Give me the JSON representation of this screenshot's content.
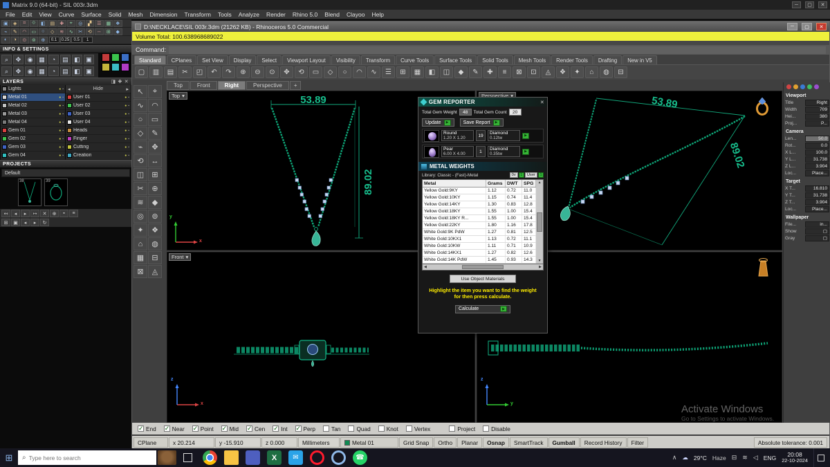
{
  "window": {
    "min": "─",
    "max": "▢",
    "close": "✕"
  },
  "icons": {
    "dd": "▾",
    "chip_arrow": "▶",
    "close": "✕",
    "plus": "+",
    "search": "⌕",
    "caret_up": "∧",
    "hide_left": "◂",
    "hide_right": "▸",
    "bulb": "●",
    "lock": "▪",
    "cloud": "☁",
    "scroll_up": "▲",
    "scroll_down": "▼",
    "scroll_left": "◀",
    "scroll_right": "▶",
    "start": "⊞",
    "tray": [
      "⊟",
      "≋",
      "◁"
    ],
    "excel_letter": "X",
    "mail_glyph": "✉",
    "whatsapp_glyph": "☎"
  },
  "matrix": {
    "title": "Matrix 9.0 (64-bit) - SIL 003r.3dm",
    "menus": [
      "File",
      "Edit",
      "View",
      "Curve",
      "Surface",
      "Solid",
      "Mesh",
      "Dimension",
      "Transform",
      "Tools",
      "Analyze",
      "Render",
      "Rhino 5.0",
      "Blend",
      "Clayoo",
      "Help"
    ],
    "toolbar_row1": [
      "▣",
      "◈",
      "⌗",
      "⟐",
      "◧",
      "▤",
      "✚",
      "⌖",
      "◎",
      "▞",
      "☰",
      "▦",
      "❖"
    ],
    "toolbar_row2": [
      "⌁",
      "✎",
      "◠",
      "▭",
      "○",
      "◇",
      "≋",
      "∿",
      "✂",
      "⟲",
      "↔",
      "⊞",
      "◆"
    ],
    "toolbar_row3": [
      "◐",
      "◑",
      "⊙",
      "⊚",
      "⊕"
    ],
    "snap_values": [
      "0.1",
      "0.25",
      "0.5",
      "1"
    ],
    "info_title": "INFO & SETTINGS",
    "info_icons": [
      "⌕",
      "✥",
      "◉",
      "▦",
      "◔",
      "▤",
      "◧",
      "▣"
    ],
    "cube_colors": [
      {
        "color": "#c43b3b"
      },
      {
        "color": "#3bc44c"
      },
      {
        "color": "#3b6ec4"
      },
      {
        "color": "#c4b63b"
      },
      {
        "color": "#3bbdc4"
      },
      {
        "color": "#b03bc4"
      }
    ],
    "layers_title": "LAYERS",
    "layers_tools": [
      "◨",
      "✚",
      "✕"
    ],
    "hide_label": "Hide",
    "layers_col1": [
      {
        "name": "Lights",
        "color": "#8a8a8a"
      },
      {
        "name": "Metal 01",
        "color": "#d8d8d8",
        "active": true
      },
      {
        "name": "Metal 02",
        "color": "#c0c0c0"
      },
      {
        "name": "Metal 03",
        "color": "#9a9a9a"
      },
      {
        "name": "Metal 04",
        "color": "#7a7a7a"
      },
      {
        "name": "Gem 01",
        "color": "#d84040"
      },
      {
        "name": "Gem 02",
        "color": "#3fc24f"
      },
      {
        "name": "Gem 03",
        "color": "#3f62c2"
      },
      {
        "name": "Gem 04",
        "color": "#2fbfbf"
      }
    ],
    "layers_col2": [
      {
        "name": "User 01",
        "color": "#d84040"
      },
      {
        "name": "User 02",
        "color": "#3fc24f"
      },
      {
        "name": "User 03",
        "color": "#3f62c2"
      },
      {
        "name": "User 04",
        "color": "#e8e8e8"
      },
      {
        "name": "Heads",
        "color": "#c28a3f"
      },
      {
        "name": "Finger",
        "color": "#bf3fbf"
      },
      {
        "name": "Cutting",
        "color": "#c2c23f"
      },
      {
        "name": "Creation",
        "color": "#3fa8c2"
      }
    ],
    "projects_title": "PROJECTS",
    "project_name": "Default",
    "thumb_labels": [
      "38",
      "39"
    ],
    "project_tools": [
      "↤",
      "◂",
      "▸",
      "↦",
      "✕",
      "⊕",
      "▪",
      "≡"
    ],
    "project_tools2": [
      "⊞",
      "▣",
      "◂",
      "▸",
      "↻"
    ]
  },
  "rhino": {
    "title": "D:\\NECKLACE\\SIL 003r.3dm (21262 KB) - Rhinoceros 5.0 Commercial",
    "volume": "Volume Total: 100.638968689022",
    "command_label": "Command:",
    "tabs": [
      {
        "label": "Standard",
        "active": true
      },
      {
        "label": "CPlanes"
      },
      {
        "label": "Set View"
      },
      {
        "label": "Display"
      },
      {
        "label": "Select"
      },
      {
        "label": "Viewport Layout"
      },
      {
        "label": "Visibility"
      },
      {
        "label": "Transform"
      },
      {
        "label": "Curve Tools"
      },
      {
        "label": "Surface Tools"
      },
      {
        "label": "Solid Tools"
      },
      {
        "label": "Mesh Tools"
      },
      {
        "label": "Render Tools"
      },
      {
        "label": "Drafting"
      },
      {
        "label": "New in V5"
      }
    ],
    "toolbar_icons": [
      "▢",
      "▥",
      "▤",
      "✂",
      "◰",
      "↶",
      "↷",
      "⊕",
      "⊖",
      "⊙",
      "✥",
      "⟲",
      "▭",
      "◇",
      "○",
      "◠",
      "∿",
      "☰",
      "⊞",
      "▦",
      "◧",
      "◫",
      "◆",
      "✎",
      "✚",
      "≡",
      "⊠",
      "⊡",
      "◬",
      "❖",
      "✦",
      "⌂",
      "◍",
      "⊟"
    ],
    "side_tools": [
      "↖",
      "⌖",
      "∿",
      "◠",
      "○",
      "▭",
      "◇",
      "✎",
      "⌁",
      "✥",
      "⟲",
      "↔",
      "◫",
      "⊞",
      "✂",
      "⊕",
      "≋",
      "◆",
      "◎",
      "⊚",
      "✦",
      "❖",
      "⌂",
      "◍",
      "▦",
      "⊟",
      "⊠",
      "◬"
    ],
    "viewport_tabs": [
      {
        "label": "Top"
      },
      {
        "label": "Front"
      },
      {
        "label": "Right",
        "active": true
      },
      {
        "label": "Perspective"
      }
    ]
  },
  "viewports": {
    "top_label": "Top",
    "front_label": "Front",
    "persp_label": "Perspective",
    "dims": {
      "w": "53.89",
      "h": "89.02"
    }
  },
  "axes": {
    "top_h": "x",
    "top_v": "y",
    "front_h": "x",
    "front_v": "z",
    "right_h": "y",
    "right_v": "z"
  },
  "gem_reporter": {
    "title": "GEM REPORTER",
    "weight_label": "Total Gem Weight",
    "weight_value": "48",
    "count_label": "Total Gem Count",
    "count_value": "20",
    "update_label": "Update",
    "save_label": "Save Report",
    "gems": [
      {
        "variant": "round",
        "shape": "Round",
        "size": "1.20 X 1.20",
        "count": "19",
        "type": "Diamond",
        "weight": "0.12tw"
      },
      {
        "variant": "pear",
        "shape": "Pear",
        "size": "6.00 X 4.00",
        "count": "1",
        "type": "Diamond",
        "weight": "0.35tw"
      }
    ]
  },
  "metal_weights": {
    "title": "METAL WEIGHTS",
    "library": "Library: Classic - (Fast)-Metal",
    "toggles": [
      {
        "label": "0v",
        "badge": "1"
      },
      {
        "label": "User",
        "badge": "1"
      }
    ],
    "columns": [
      "Metal",
      "Grams",
      "DWT",
      "SPG"
    ],
    "rows": [
      [
        "Yellow Gold:9KY",
        "1.12",
        "0.72",
        "11.0"
      ],
      [
        "Yellow Gold:10KY",
        "1.15",
        "0.74",
        "11.4"
      ],
      [
        "Yellow Gold:14KY",
        "1.30",
        "0.83",
        "12.8"
      ],
      [
        "Yellow Gold:18KY",
        "1.55",
        "1.00",
        "15.4"
      ],
      [
        "Yellow Gold:18KY R...",
        "1.55",
        "1.00",
        "15.4"
      ],
      [
        "Yellow Gold:22KY",
        "1.80",
        "1.16",
        "17.8"
      ],
      [
        "White Gold:9K PdW",
        "1.27",
        "0.81",
        "12.5"
      ],
      [
        "White Gold:10KX1",
        "1.13",
        "0.72",
        "11.1"
      ],
      [
        "White Gold:10KW",
        "1.11",
        "0.71",
        "10.9"
      ],
      [
        "White Gold:14KX1",
        "1.27",
        "0.82",
        "12.6"
      ],
      [
        "White Gold:14K PdW",
        "1.45",
        "0.93",
        "14.3"
      ]
    ],
    "uom_label": "Use Object Materials",
    "instr1": "Highlight the item you want to find the weight",
    "instr2": "for then press calculate.",
    "calculate_label": "Calculate"
  },
  "props": {
    "sections": [
      {
        "title": "Viewport",
        "rows": [
          [
            "Title",
            "Right"
          ],
          [
            "Width",
            "709"
          ],
          [
            "Hei...",
            "380"
          ],
          [
            "Proj...",
            "P..."
          ]
        ]
      },
      {
        "title": "Camera",
        "rows": [
          [
            "Len...",
            "50.0"
          ],
          [
            "Rot...",
            "0.0"
          ],
          [
            "X L...",
            "100.0"
          ],
          [
            "Y L...",
            "31.738"
          ],
          [
            "Z L...",
            "3.904"
          ],
          [
            "Loc...",
            "Place..."
          ]
        ]
      },
      {
        "title": "Target",
        "rows": [
          [
            "X T...",
            "16.810"
          ],
          [
            "Y T...",
            "31.738"
          ],
          [
            "Z T...",
            "3.904"
          ],
          [
            "Loc...",
            "Place..."
          ]
        ]
      },
      {
        "title": "Wallpaper",
        "rows": [
          [
            "File...",
            "in..."
          ],
          [
            "Show",
            "▢"
          ],
          [
            "Gray",
            "▢"
          ]
        ]
      }
    ]
  },
  "osnap": {
    "items": [
      {
        "label": "End",
        "checked": true
      },
      {
        "label": "Near",
        "checked": true
      },
      {
        "label": "Point",
        "checked": true
      },
      {
        "label": "Mid",
        "checked": true
      },
      {
        "label": "Cen",
        "checked": true
      },
      {
        "label": "Int",
        "checked": true
      },
      {
        "label": "Perp",
        "checked": true
      },
      {
        "label": "Tan"
      },
      {
        "label": "Quad"
      },
      {
        "label": "Knot"
      },
      {
        "label": "Vertex"
      },
      {
        "label": "Project"
      },
      {
        "label": "Disable"
      }
    ]
  },
  "status": {
    "cplane": "CPlane",
    "x": "x 20.214",
    "y": "y -15.910",
    "z": "z 0.000",
    "units": "Millimeters",
    "layer": "Metal 01",
    "buttons": [
      {
        "label": "Grid Snap"
      },
      {
        "label": "Ortho"
      },
      {
        "label": "Planar"
      },
      {
        "label": "Osnap",
        "bold": true
      },
      {
        "label": "SmartTrack"
      },
      {
        "label": "Gumball",
        "bold": true
      },
      {
        "label": "Record History"
      },
      {
        "label": "Filter"
      }
    ],
    "tolerance": "Absolute tolerance: 0.001"
  },
  "taskbar": {
    "search_placeholder": "Type here to search",
    "weather_temp": "29°C",
    "weather_cond": "Haze",
    "lang": "ENG",
    "time": "20:08",
    "date": "22-10-2024"
  },
  "watermark": {
    "line1": "Activate Windows",
    "line2": "Go to Settings to activate Windows."
  }
}
